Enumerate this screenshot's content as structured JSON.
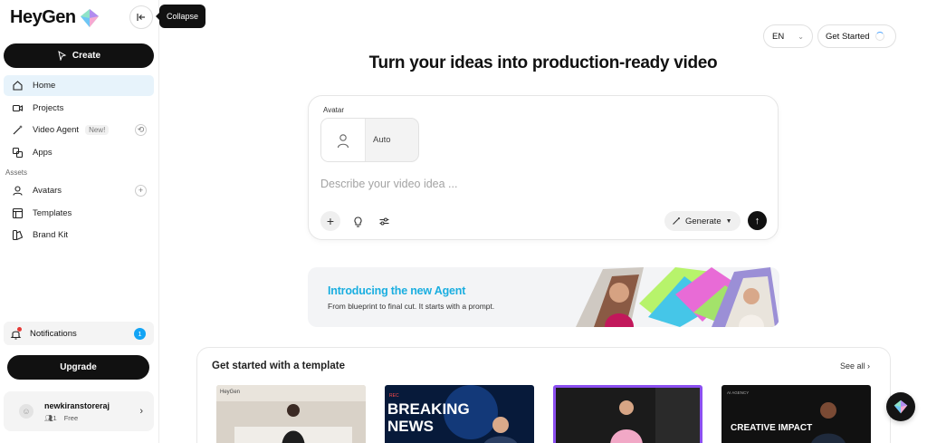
{
  "brand": {
    "name": "HeyGen"
  },
  "sidebar": {
    "collapse_tooltip": "Collapse",
    "create_label": "Create",
    "items": [
      {
        "label": "Home",
        "icon": "home-icon",
        "active": true
      },
      {
        "label": "Projects",
        "icon": "video-camera-icon"
      },
      {
        "label": "Video Agent",
        "icon": "magic-wand-icon",
        "badge": "New!"
      },
      {
        "label": "Apps",
        "icon": "apps-icon"
      }
    ],
    "assets_label": "Assets",
    "asset_items": [
      {
        "label": "Avatars",
        "icon": "person-icon"
      },
      {
        "label": "Templates",
        "icon": "layout-icon"
      },
      {
        "label": "Brand Kit",
        "icon": "brand-kit-icon"
      }
    ],
    "notifications": {
      "label": "Notifications",
      "count": "1"
    },
    "upgrade_label": "Upgrade",
    "user": {
      "name": "newkiranstoreraj",
      "seats": "1",
      "plan": "Free"
    }
  },
  "header": {
    "language": "EN",
    "get_started": "Get Started"
  },
  "hero": {
    "title": "Turn your ideas into production-ready video",
    "avatar_label": "Avatar",
    "avatar_value": "Auto",
    "prompt_placeholder": "Describe your video idea ...",
    "generate_label": "Generate"
  },
  "banner": {
    "title": "Introducing the new Agent",
    "subtitle": "From blueprint to final cut. It starts with a prompt."
  },
  "templates": {
    "title": "Get started with a template",
    "see_all": "See all",
    "cards": [
      {
        "logo": "HeyGen",
        "caption": ""
      },
      {
        "tag": "REC",
        "caption": "BREAKING NEWS"
      },
      {
        "caption": ""
      },
      {
        "tag": "AI AGENCY",
        "caption": "CREATIVE IMPACT"
      }
    ]
  },
  "colors": {
    "accent": "#1aaee0",
    "primary": "#111111",
    "active_bg": "#e7f3fb",
    "badge": "#12a4f5"
  }
}
